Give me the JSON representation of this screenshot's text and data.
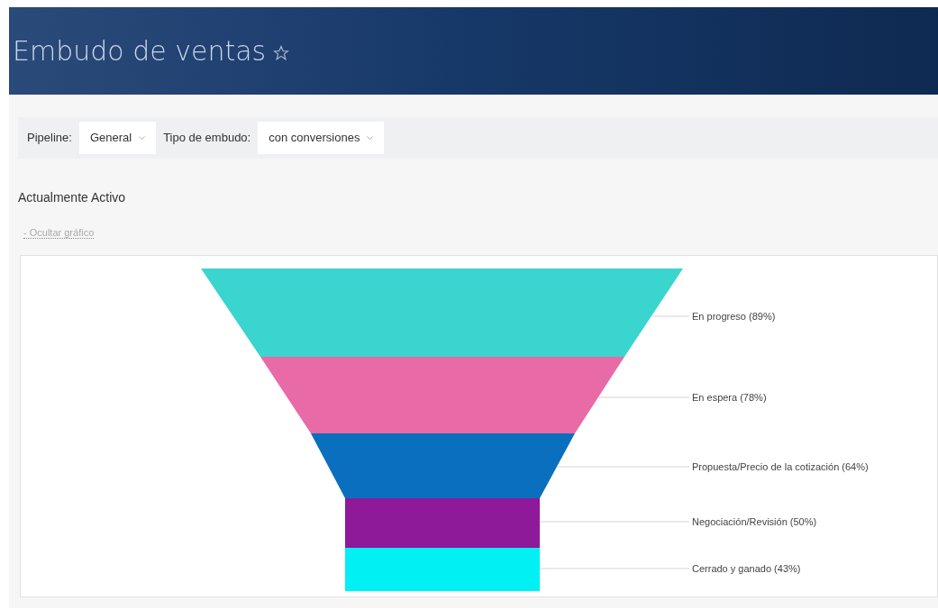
{
  "header": {
    "title": "Embudo de ventas"
  },
  "filters": [
    {
      "label": "Pipeline:",
      "value": "General"
    },
    {
      "label": "Tipo de embudo:",
      "value": "con conversiones"
    }
  ],
  "section_title": "Actualmente Activo",
  "toggle_link": "- Ocultar gráfico",
  "funnel": [
    {
      "label": "En progreso (89%)",
      "color": "#3ad5cf"
    },
    {
      "label": "En espera (78%)",
      "color": "#e86aa6"
    },
    {
      "label": "Propuesta/Precio de la cotización (64%)",
      "color": "#0a6fbf"
    },
    {
      "label": "Negociación/Revisión (50%)",
      "color": "#8e1a9a"
    },
    {
      "label": "Cerrado y ganado (43%)",
      "color": "#00f0f4"
    }
  ]
}
